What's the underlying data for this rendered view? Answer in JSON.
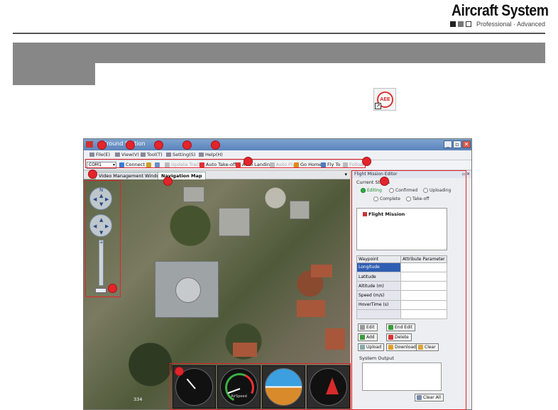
{
  "header": {
    "brand_title": "Aircraft System",
    "brand_subtitle": "Professional · Advanced"
  },
  "app_icon": {
    "label": "AEE"
  },
  "window": {
    "title": "Ground Station",
    "controls": [
      "_",
      "▫",
      "✕"
    ]
  },
  "menu": [
    {
      "label": "File(E)",
      "icon": "file-icon"
    },
    {
      "label": "View(V)",
      "icon": "view-icon"
    },
    {
      "label": "Tool(T)",
      "icon": "tool-icon"
    },
    {
      "label": "Setting(S)",
      "icon": "setting-icon"
    },
    {
      "label": "Help(H)",
      "icon": "help-icon"
    }
  ],
  "toolbar": {
    "port": "COM1",
    "connect": "Connect",
    "upload_track": "Update Track",
    "auto_takeoff": "Auto Take-off",
    "auto_landing": "Auto Landing",
    "auto_fly": "Auto Fly",
    "go_home": "Go Home",
    "fly_to": "Fly To",
    "extra": "Follow"
  },
  "tabs": {
    "video": "Video Management Window",
    "map": "Navigation Map",
    "menu_glyph": "▾"
  },
  "map": {
    "north": "N",
    "zoom_in": "+",
    "zoom_out": "−",
    "scale": "334"
  },
  "instruments": {
    "airspeed_label": "AirSpeed"
  },
  "editor": {
    "title": "Flight Mission Editor",
    "pin": "▫ ✕",
    "status_title": "Current Status",
    "status": {
      "editing": "Editing",
      "confirmed": "Confirmed",
      "uploading": "Uploading",
      "complete": "Complete",
      "takeoff": "Take-off"
    },
    "tree_item": "Flight Mission",
    "grid_headers": [
      "Waypoint",
      "Attribute Parameter"
    ],
    "grid_rows": [
      "Longitude",
      "Latitude",
      "Altitude (m)",
      "Speed (m/s)",
      "HoverTime (s)"
    ],
    "buttons": {
      "edit": "Edit",
      "end_edit": "End Edit",
      "add": "Add",
      "delete": "Delete",
      "upload": "Upload",
      "download": "Download",
      "clear": "Clear"
    },
    "output_title": "System Output",
    "clear_all": "Clear All"
  },
  "colors": {
    "callout": "#e3242b",
    "band": "#878787",
    "selection": "#2f5fb3"
  }
}
